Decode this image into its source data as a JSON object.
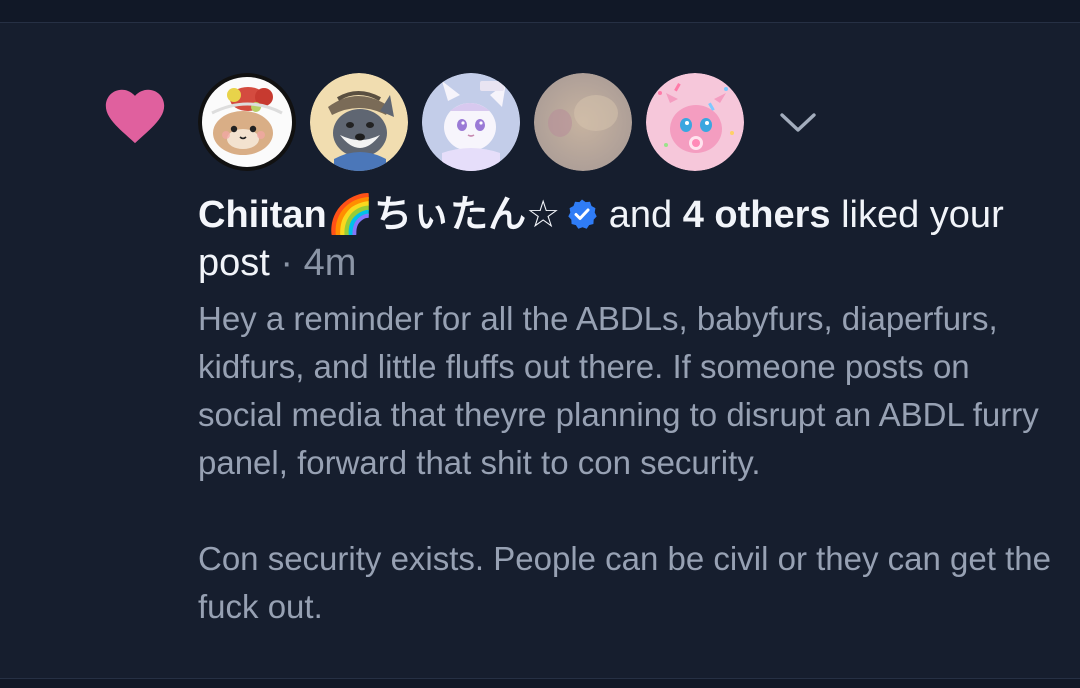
{
  "notification": {
    "actor_name": "Chiitan🌈ちぃたん☆",
    "and_text": "and",
    "others_count": "4 others",
    "liked_text": "liked",
    "your_post_text": "your post",
    "separator": "·",
    "time_ago": "4m",
    "post_paragraphs": [
      "Hey a reminder for all the ABDLs, babyfurs, diaperfurs, kidfurs, and little fluffs out there. If someone posts on social media that theyre planning to disrupt an ABDL furry panel, forward that shit to con security.",
      "Con security exists. People can be civil or they can get the fuck out."
    ]
  },
  "icons": {
    "heart": "heart-icon",
    "verified": "verified-badge-icon",
    "expand": "chevron-down-icon"
  },
  "colors": {
    "background": "#161e2e",
    "heart": "#e0609e",
    "verified": "#2f7cf6",
    "text_primary": "#f1f4f9",
    "text_secondary": "#97a1b3"
  }
}
